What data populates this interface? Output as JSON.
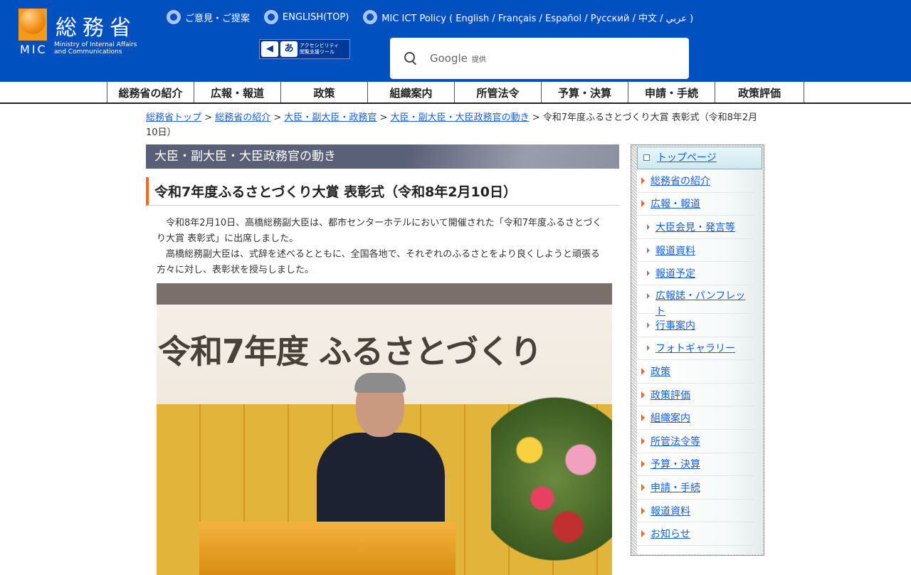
{
  "header": {
    "logo_kanji": "総務省",
    "logo_mic": "MIC",
    "logo_en": [
      "Ministry of Internal Affairs",
      "and Communications"
    ],
    "links": [
      "ご意見・ご提案",
      "ENGLISH(TOP)",
      "MIC ICT Policy ( English / Français / Español / Русский / 中文 / عربي )"
    ],
    "access_label": [
      "アクセシビリティ",
      "閲覧支援ツール"
    ],
    "access_icon_text": "あ",
    "search": {
      "brand": "Google",
      "suffix": "提供"
    }
  },
  "gnav": [
    "総務省の紹介",
    "広報・報道",
    "政策",
    "組織案内",
    "所管法令",
    "予算・決算",
    "申請・手続",
    "政策評価"
  ],
  "breadcrumb": {
    "links": [
      "総務省トップ",
      "総務省の紹介",
      "大臣・副大臣・政務官",
      "大臣・副大臣・大臣政務官の動き"
    ],
    "separator": " > ",
    "current": "令和7年度ふるさとづくり大賞 表彰式（令和8年2月10日）"
  },
  "main": {
    "section_title": "大臣・副大臣・大臣政務官の動き",
    "title": "令和7年度ふるさとづくり大賞 表彰式（令和8年2月10日）",
    "paragraphs": [
      "令和8年2月10日、高橋総務副大臣は、都市センターホテルにおいて開催された「令和7年度ふるさとづくり大賞 表彰式」に出席しました。",
      "高橋総務副大臣は、式辞を述べるとともに、全国各地で、それぞれのふるさとをより良くしようと頑張る方々に対し、表彰状を授与しました。"
    ],
    "photo_banner": "令和7年度 ふるさとづくり"
  },
  "sidebar": {
    "top": "トップページ",
    "items": [
      {
        "label": "総務省の紹介",
        "sub": false
      },
      {
        "label": "広報・報道",
        "sub": false
      },
      {
        "label": "大臣会見・発言等",
        "sub": true
      },
      {
        "label": "報道資料",
        "sub": true
      },
      {
        "label": "報道予定",
        "sub": true
      },
      {
        "label": "広報誌・パンフレット",
        "sub": true
      },
      {
        "label": "行事案内",
        "sub": true
      },
      {
        "label": "フォトギャラリー",
        "sub": true
      },
      {
        "label": "政策",
        "sub": false
      },
      {
        "label": "政策評価",
        "sub": false
      },
      {
        "label": "組織案内",
        "sub": false
      },
      {
        "label": "所管法令等",
        "sub": false
      },
      {
        "label": "予算・決算",
        "sub": false
      },
      {
        "label": "申請・手続",
        "sub": false
      },
      {
        "label": "報道資料",
        "sub": false
      },
      {
        "label": "お知らせ",
        "sub": false
      }
    ]
  },
  "colors": {
    "header": "#0050c0",
    "accent": "#f06a1a",
    "link": "#1a5fd6"
  }
}
